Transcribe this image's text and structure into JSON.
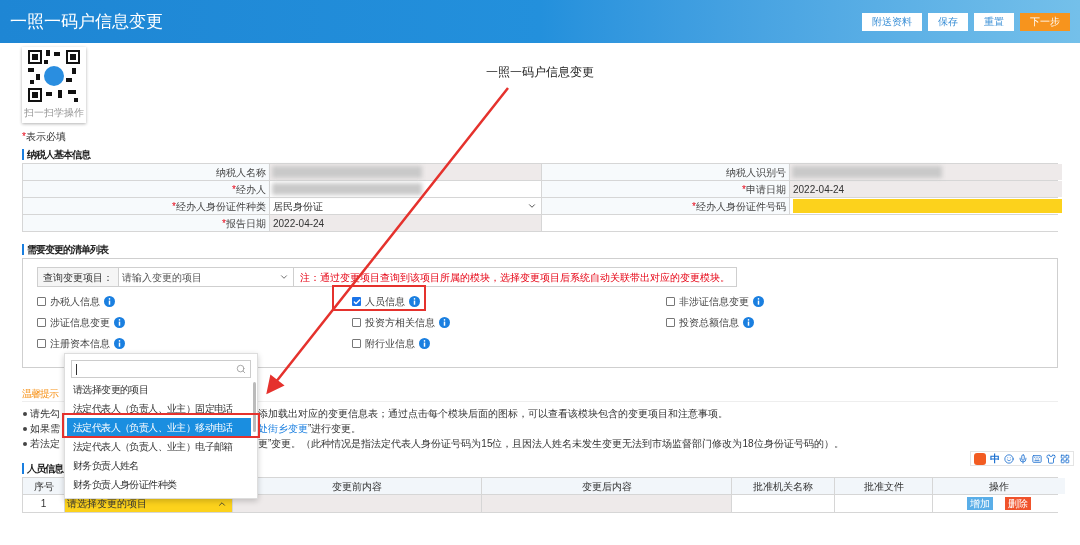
{
  "header": {
    "title": "一照一码户信息变更",
    "buttons": [
      {
        "label": "附送资料",
        "kind": "plain"
      },
      {
        "label": "保存",
        "kind": "plain"
      },
      {
        "label": "重置",
        "kind": "plain"
      },
      {
        "label": "下一步",
        "kind": "primary"
      }
    ]
  },
  "qr": {
    "caption": "扫一扫学操作"
  },
  "page_title": "一照一码户信息变更",
  "required_note": {
    "mark": "*",
    "text": "表示必填"
  },
  "basic_info": {
    "title": "纳税人基本信息",
    "rows": [
      [
        {
          "label": "纳税人名称",
          "required": false,
          "kind": "redacted",
          "readonly": true
        },
        {
          "label": "纳税人识别号",
          "required": false,
          "kind": "redacted",
          "readonly": true
        }
      ],
      [
        {
          "label": "经办人",
          "required": true,
          "kind": "redacted",
          "readonly": false
        },
        {
          "label": "申请日期",
          "required": true,
          "kind": "text",
          "value": "2022-04-24",
          "readonly": true
        }
      ],
      [
        {
          "label": "经办人身份证件种类",
          "required": true,
          "kind": "select",
          "value": "居民身份证",
          "readonly": false
        },
        {
          "label": "经办人身份证件号码",
          "required": true,
          "kind": "highlight",
          "readonly": false
        }
      ],
      [
        {
          "label": "报告日期",
          "required": true,
          "kind": "text",
          "value": "2022-04-24",
          "readonly": true
        },
        {
          "kind": "empty"
        }
      ]
    ]
  },
  "change_list": {
    "title": "需要变更的清单列表",
    "query_label": "查询变更项目：",
    "query_placeholder": "请输入变更的项目",
    "note": "注：通过变更项目查询到该项目所属的模块，选择变更项目后系统自动关联带出对应的变更模块。",
    "modules": [
      {
        "label": "办税人信息",
        "checked": false
      },
      {
        "label": "人员信息",
        "checked": true
      },
      {
        "label": "非涉证信息变更",
        "checked": false
      },
      {
        "label": "涉证信息变更",
        "checked": false
      },
      {
        "label": "投资方相关信息",
        "checked": false
      },
      {
        "label": "投资总额信息",
        "checked": false
      },
      {
        "label": "注册资本信息",
        "checked": false
      },
      {
        "label": "附行业信息",
        "checked": false
      }
    ]
  },
  "tips": {
    "title": "温馨提示",
    "bullets": [
      {
        "left": "请先勾",
        "right": "添加载出对应的变更信息表；通过点击每个模块后面的图标，可以查看该模块包含的变更项目和注意事项。"
      },
      {
        "left": "如果需",
        "link": "处街乡变更",
        "right": "”进行变更。"
      },
      {
        "left": "若法定",
        "right": "更”变更。（此种情况是指法定代表人身份证号码为15位，且因法人姓名未发生变更无法到市场监督部门修改为18位身份证号码的）。"
      }
    ]
  },
  "personnel": {
    "title": "人员信息",
    "columns": [
      "序号",
      "变更前内容",
      "变更后内容",
      "批准机关名称",
      "批准文件",
      "操作"
    ],
    "rows": [
      {
        "index": "1",
        "item": "请选择变更的项目",
        "expanded": true,
        "actions": [
          {
            "label": "增加",
            "kind": "add"
          },
          {
            "label": "删除",
            "kind": "delete"
          }
        ]
      }
    ]
  },
  "dropdown": {
    "options": [
      {
        "label": "请选择变更的项目",
        "selected": false
      },
      {
        "label": "法定代表人（负责人、业主）固定电话",
        "selected": false
      },
      {
        "label": "法定代表人（负责人、业主）移动电话",
        "selected": true
      },
      {
        "label": "法定代表人（负责人、业主）电子邮箱",
        "selected": false
      },
      {
        "label": "财务负责人姓名",
        "selected": false
      },
      {
        "label": "财务负责人身份证件种类",
        "selected": false
      }
    ]
  },
  "ime_toolbar": {
    "mode": "中"
  }
}
